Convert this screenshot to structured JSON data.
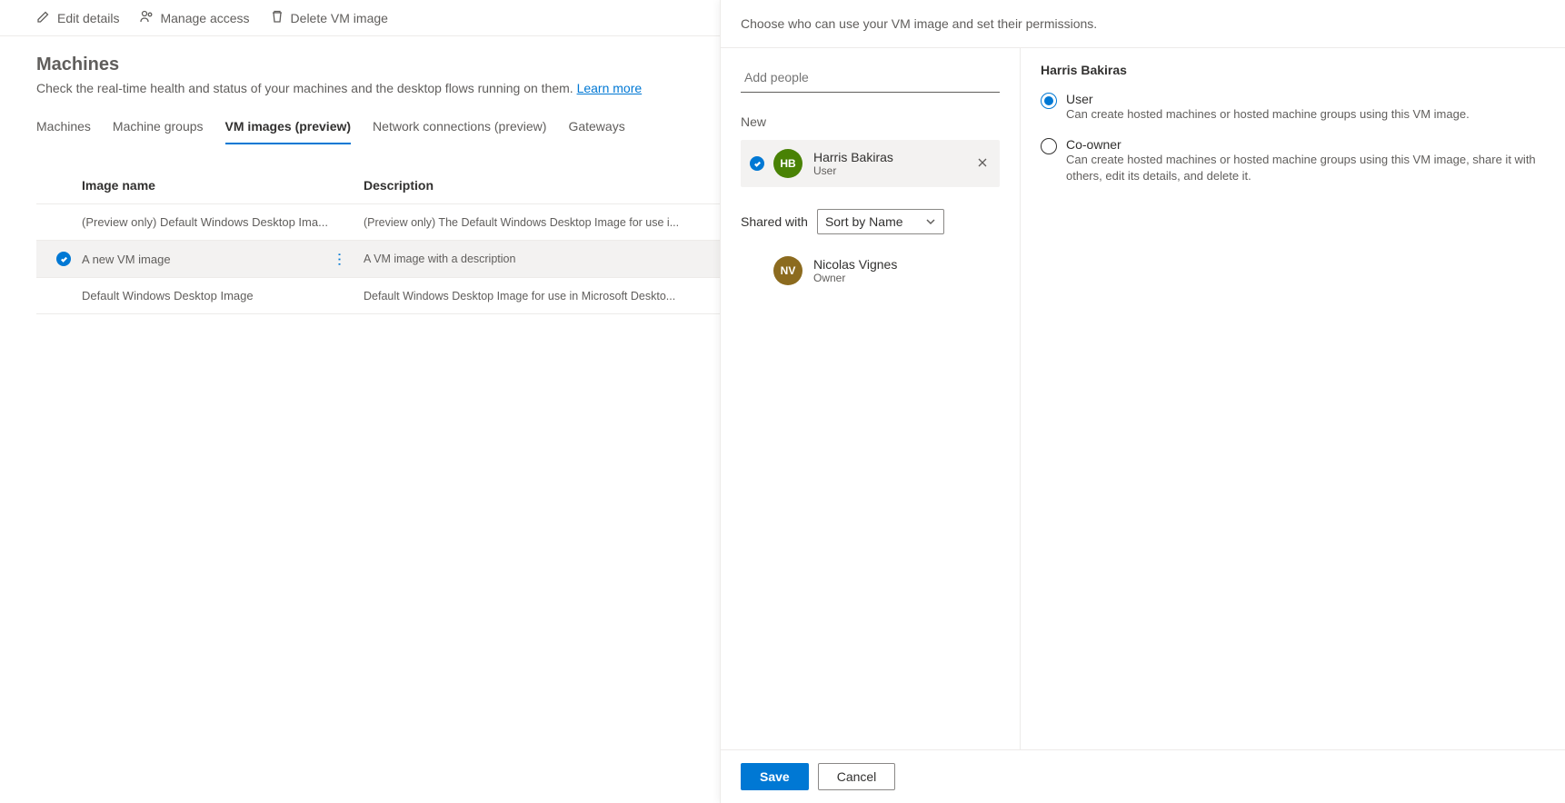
{
  "toolbar": {
    "edit_label": "Edit details",
    "manage_label": "Manage access",
    "delete_label": "Delete VM image"
  },
  "page": {
    "title": "Machines",
    "subtitle_prefix": "Check the real-time health and status of your machines and the desktop flows running on them. ",
    "learn_more": "Learn more"
  },
  "tabs": {
    "machines": "Machines",
    "groups": "Machine groups",
    "vm_images": "VM images (preview)",
    "network": "Network connections (preview)",
    "gateways": "Gateways"
  },
  "table": {
    "col_name": "Image name",
    "col_desc": "Description",
    "rows": [
      {
        "name": "(Preview only) Default Windows Desktop Ima...",
        "desc": "(Preview only) The Default Windows Desktop Image for use i...",
        "selected": false
      },
      {
        "name": "A new VM image",
        "desc": "A VM image with a description",
        "selected": true
      },
      {
        "name": "Default Windows Desktop Image",
        "desc": "Default Windows Desktop Image for use in Microsoft Deskto...",
        "selected": false
      }
    ]
  },
  "panel": {
    "header": "Choose who can use your VM image and set their permissions.",
    "add_placeholder": "Add people",
    "new_label": "New",
    "new_person": {
      "initials": "HB",
      "name": "Harris Bakiras",
      "role": "User"
    },
    "shared_with_label": "Shared with",
    "sort_label": "Sort by Name",
    "owner": {
      "initials": "NV",
      "name": "Nicolas Vignes",
      "role": "Owner"
    },
    "detail": {
      "name": "Harris Bakiras",
      "options": [
        {
          "label": "User",
          "desc": "Can create hosted machines or hosted machine groups using this VM image.",
          "checked": true
        },
        {
          "label": "Co-owner",
          "desc": "Can create hosted machines or hosted machine groups using this VM image, share it with others, edit its details, and delete it.",
          "checked": false
        }
      ]
    },
    "save": "Save",
    "cancel": "Cancel"
  }
}
